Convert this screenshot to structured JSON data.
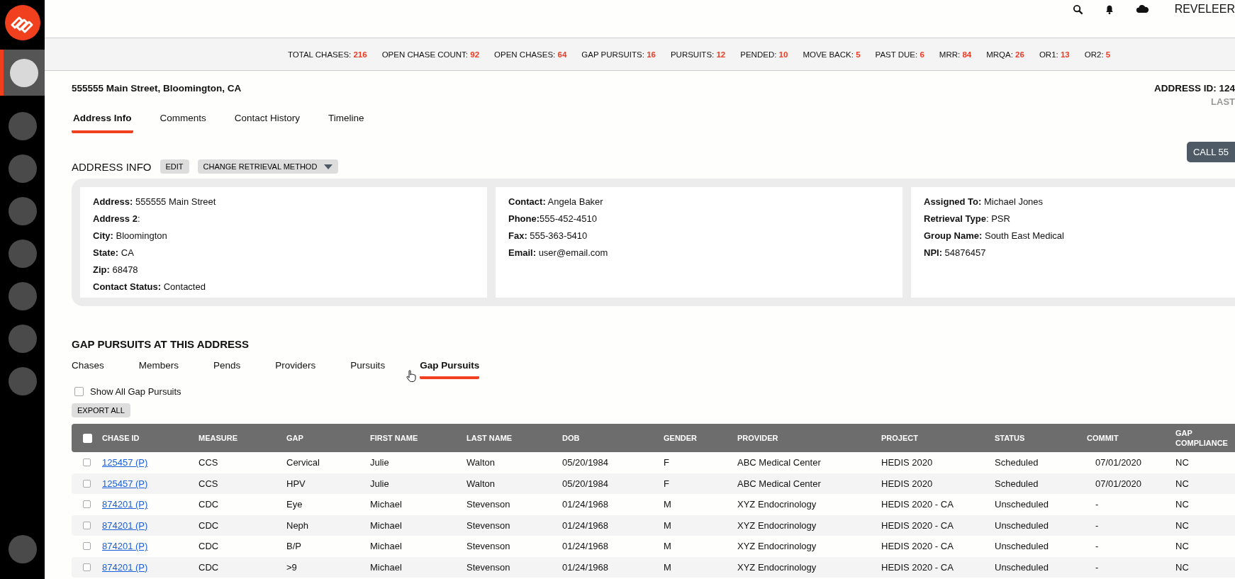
{
  "header": {
    "brand": "REVELEER"
  },
  "sidebar": {
    "items": [
      {
        "selected": true
      },
      {
        "selected": false
      },
      {
        "selected": false
      },
      {
        "selected": false
      },
      {
        "selected": false
      },
      {
        "selected": false
      },
      {
        "selected": false
      },
      {
        "selected": false
      }
    ]
  },
  "stats": [
    {
      "label": "TOTAL CHASES:",
      "value": "216"
    },
    {
      "label": "OPEN CHASE COUNT:",
      "value": "92"
    },
    {
      "label": "OPEN CHASES:",
      "value": "64"
    },
    {
      "label": "GAP PURSUITS:",
      "value": "16"
    },
    {
      "label": "PURSUITS:",
      "value": "12"
    },
    {
      "label": "PENDED:",
      "value": "10"
    },
    {
      "label": "MOVE BACK:",
      "value": "5"
    },
    {
      "label": "PAST DUE:",
      "value": "6"
    },
    {
      "label": "MRR:",
      "value": "84"
    },
    {
      "label": "MRQA:",
      "value": "26"
    },
    {
      "label": "OR1:",
      "value": "13"
    },
    {
      "label": "OR2:",
      "value": "5"
    }
  ],
  "address_title": "555555 Main Street, Bloomington, CA",
  "address_id": "ADDRESS ID: 124",
  "address_sub": "LAST",
  "tabs": [
    {
      "label": "Address Info",
      "selected": true
    },
    {
      "label": "Comments",
      "selected": false
    },
    {
      "label": "Contact History",
      "selected": false
    },
    {
      "label": "Timeline",
      "selected": false
    }
  ],
  "address_info": {
    "title": "ADDRESS INFO",
    "edit_button": "EDIT",
    "retrieval_button": "CHANGE RETRIEVAL METHOD",
    "call_button": "CALL 55",
    "cards": [
      [
        "**Address:** 555555 Main Street",
        "**Address 2**:",
        "**City:** Bloomington",
        "**State:** CA",
        "**Zip:** 68478",
        "**Contact Status:** Contacted"
      ],
      [
        "**Contact:** Angela Baker",
        "**Phone:**555-452-4510",
        "**Fax:** 555-363-5410",
        "**Email:** user@email.com"
      ],
      [
        "**Assigned To:** Michael Jones",
        "**Retrieval Type**: PSR",
        "**Group Name:** South East Medical",
        "**NPI:** 54876457"
      ]
    ]
  },
  "pursuits": {
    "title": "GAP PURSUITS AT THIS ADDRESS",
    "tabs": [
      {
        "label": "Chases",
        "selected": false
      },
      {
        "label": "Members",
        "selected": false
      },
      {
        "label": "Pends",
        "selected": false
      },
      {
        "label": "Providers",
        "selected": false
      },
      {
        "label": "Pursuits",
        "selected": false
      },
      {
        "label": "Gap Pursuits",
        "selected": true
      }
    ],
    "show_all": {
      "label": "Show All Gap Pursuits",
      "checked": false
    },
    "export_button": "EXPORT ALL",
    "table": {
      "select_all_checked": false,
      "columns": [
        "CHASE ID",
        "MEASURE",
        "GAP",
        "FIRST NAME",
        "LAST NAME",
        "DOB",
        "GENDER",
        "PROVIDER",
        "PROJECT",
        "STATUS",
        "COMMIT",
        "GAP COMPLIANCE"
      ],
      "rows": [
        {
          "checked": false,
          "cells": [
            "125457 (P)",
            "CCS",
            "Cervical",
            "Julie",
            "Walton",
            "05/20/1984",
            "F",
            "ABC Medical Center",
            "HEDIS 2020",
            "Scheduled",
            "07/01/2020",
            "NC"
          ]
        },
        {
          "checked": false,
          "cells": [
            "125457 (P)",
            "CCS",
            "HPV",
            "Julie",
            "Walton",
            "05/20/1984",
            "F",
            "ABC Medical Center",
            "HEDIS 2020",
            "Scheduled",
            "07/01/2020",
            "NC"
          ]
        },
        {
          "checked": false,
          "cells": [
            "874201 (P)",
            "CDC",
            "Eye",
            "Michael",
            "Stevenson",
            "01/24/1968",
            "M",
            "XYZ Endocrinology",
            "HEDIS 2020 - CA",
            "Unscheduled",
            "-",
            "NC"
          ]
        },
        {
          "checked": false,
          "cells": [
            "874201 (P)",
            "CDC",
            "Neph",
            "Michael",
            "Stevenson",
            "01/24/1968",
            "M",
            "XYZ Endocrinology",
            "HEDIS 2020 - CA",
            "Unscheduled",
            "-",
            "NC"
          ]
        },
        {
          "checked": false,
          "cells": [
            "874201 (P)",
            "CDC",
            "B/P",
            "Michael",
            "Stevenson",
            "01/24/1968",
            "M",
            "XYZ Endocrinology",
            "HEDIS 2020 - CA",
            "Unscheduled",
            "-",
            "NC"
          ]
        },
        {
          "checked": false,
          "cells": [
            "874201 (P)",
            "CDC",
            ">9",
            "Michael",
            "Stevenson",
            "01/24/1968",
            "M",
            "XYZ Endocrinology",
            "HEDIS 2020 - CA",
            "Unscheduled",
            "-",
            "NC"
          ]
        }
      ]
    }
  }
}
